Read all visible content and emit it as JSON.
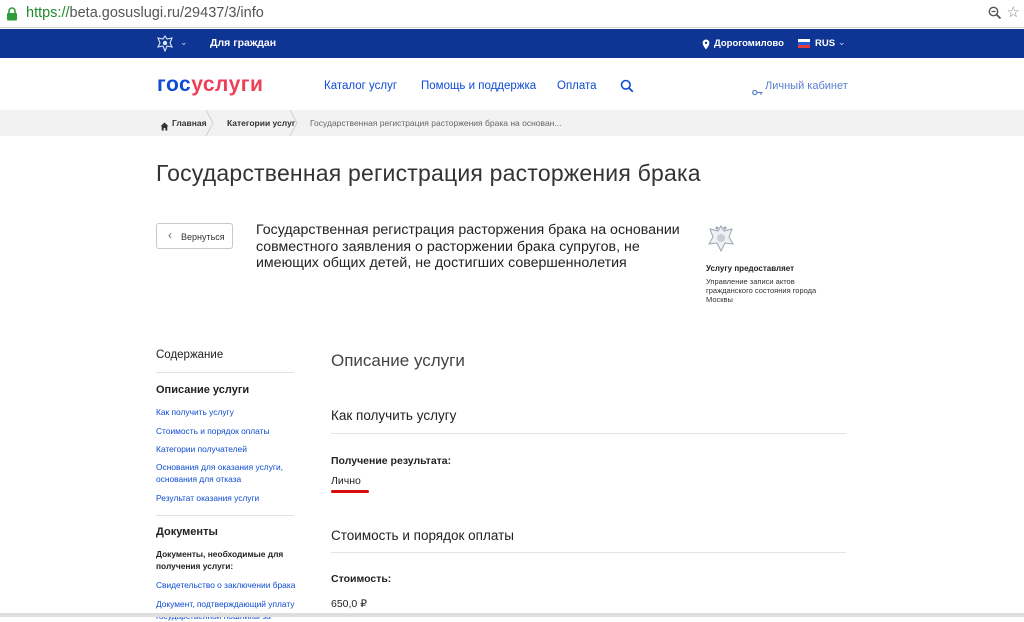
{
  "browser": {
    "url_scheme": "https://",
    "url_rest": "beta.gosuslugi.ru/29437/3/info"
  },
  "topbar": {
    "for_citizens": "Для граждан",
    "location": "Дорогомилово",
    "language": "RUS",
    "colors": {
      "background": "#0e3594"
    }
  },
  "header": {
    "logo_part1": "гос",
    "logo_part2": "услуги",
    "nav": [
      "Каталог услуг",
      "Помощь и поддержка",
      "Оплата"
    ],
    "cabinet": "Личный кабинет",
    "colors": {
      "brand_blue": "#0d4cd3",
      "brand_red": "#ee3f58"
    }
  },
  "breadcrumbs": [
    "Главная",
    "Категории услуг",
    "Государственная регистрация расторжения брака на основан..."
  ],
  "page": {
    "title": "Государственная регистрация расторжения брака",
    "back_label": "Вернуться",
    "service_full": "Государственная регистрация расторжения брака на основании совместного заявления о расторжении брака супругов, не имеющих общих детей, не достигших совершеннолетия",
    "provider_head": "Услугу предоставляет",
    "provider_name": "Управление записи актов гражданского состояния города Москвы"
  },
  "toc": {
    "title": "Содержание",
    "section1": "Описание услуги",
    "links1": [
      "Как получить услугу",
      "Стоимость и порядок оплаты",
      "Категории получателей",
      "Основания для оказания услуги, основания для отказа",
      "Результат оказания услуги"
    ],
    "section2": "Документы",
    "sub2": "Документы, необходимые для получения услуги:",
    "links2": [
      "Свидетельство о заключении брака",
      "Документ, подтверждающий уплату государственной пошлины за"
    ]
  },
  "main": {
    "heading": "Описание услуги",
    "how_heading": "Как получить услугу",
    "result_label": "Получение результата:",
    "result_value": "Лично",
    "cost_heading": "Стоимость и порядок оплаты",
    "cost_label": "Стоимость:",
    "cost_value": "650,0 ₽"
  }
}
